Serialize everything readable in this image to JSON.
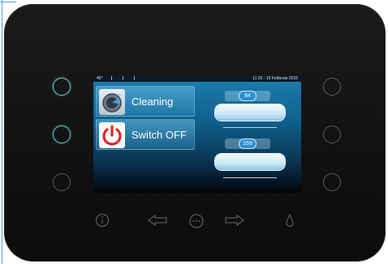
{
  "statusbar": {
    "temperature": "45°",
    "datetime": "11:25 - 19 Febbraio 2015"
  },
  "menu": {
    "cleaning_label": "Cleaning",
    "switch_off_label": "Switch OFF"
  },
  "gauges": {
    "top_value": "84",
    "bottom_value": "159"
  },
  "icons": {
    "cleaning": "cleaning-icon",
    "power": "power-icon",
    "info": "info-icon",
    "left_arrow": "left-arrow-icon",
    "menu_dots": "menu-dots-icon",
    "right_arrow": "right-arrow-icon",
    "drop": "water-drop-icon"
  },
  "colors": {
    "led_on": "#5fd3d8",
    "led_off": "#5a5a5c",
    "power_red": "#d8282e",
    "screen_blue": "#1c7fb0"
  }
}
